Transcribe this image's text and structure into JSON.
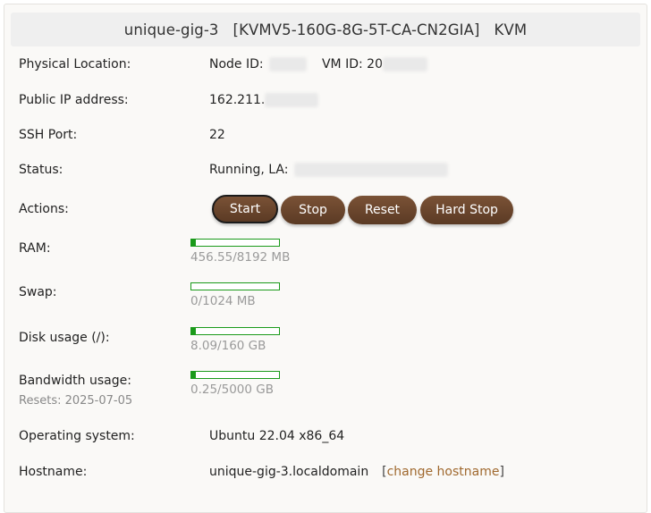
{
  "header": {
    "name": "unique-gig-3",
    "plan": "[KVMV5-160G-8G-5T-CA-CN2GIA]",
    "type": "KVM"
  },
  "location": {
    "label": "Physical Location:",
    "node_label": "Node ID:",
    "vm_label": "VM ID:",
    "vm_prefix": "20"
  },
  "ip": {
    "label": "Public IP address:",
    "prefix": "162.211."
  },
  "ssh": {
    "label": "SSH Port:",
    "value": "22"
  },
  "status": {
    "label": "Status:",
    "value": "Running, LA:"
  },
  "actions": {
    "label": "Actions:",
    "start": "Start",
    "stop": "Stop",
    "reset": "Reset",
    "hard_stop": "Hard Stop"
  },
  "ram": {
    "label": "RAM:",
    "usage": "456.55/8192 MB",
    "fraction": 0.0557
  },
  "swap": {
    "label": "Swap:",
    "usage": "0/1024 MB",
    "fraction": 0
  },
  "disk": {
    "label": "Disk usage (/):",
    "usage": "8.09/160 GB",
    "fraction": 0.0506
  },
  "bandwidth": {
    "label": "Bandwidth usage:",
    "resets": "Resets: 2025-07-05",
    "usage": "0.25/5000 GB",
    "fraction": 5e-05
  },
  "os": {
    "label": "Operating system:",
    "value": "Ubuntu 22.04 x86_64"
  },
  "hostname": {
    "label": "Hostname:",
    "value": "unique-gig-3.localdomain",
    "open_bracket": "[",
    "change_link": "change hostname",
    "close_bracket": "]"
  },
  "colors": {
    "button": "#6b452d",
    "bar": "#1a9a1a",
    "link": "#a0692f"
  }
}
